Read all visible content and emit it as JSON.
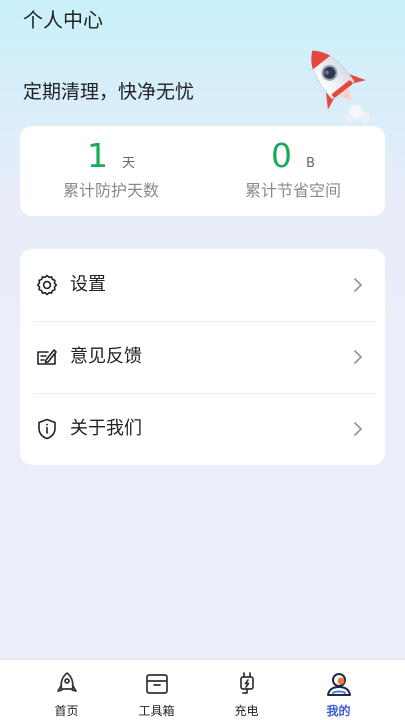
{
  "header": {
    "title": "个人中心",
    "slogan": "定期清理，快净无忧"
  },
  "stats": {
    "protection": {
      "value": "1",
      "unit": "天",
      "label": "累计防护天数"
    },
    "saved": {
      "value": "0",
      "unit": "B",
      "label": "累计节省空间"
    }
  },
  "menu": {
    "items": [
      {
        "label": "设置",
        "icon": "gear-icon"
      },
      {
        "label": "意见反馈",
        "icon": "feedback-icon"
      },
      {
        "label": "关于我们",
        "icon": "shield-info-icon"
      }
    ]
  },
  "tabbar": {
    "tabs": [
      {
        "label": "首页",
        "icon": "rocket-icon"
      },
      {
        "label": "工具箱",
        "icon": "toolbox-icon"
      },
      {
        "label": "充电",
        "icon": "charger-icon"
      },
      {
        "label": "我的",
        "icon": "user-icon"
      }
    ],
    "active_index": 3
  },
  "colors": {
    "accent": "#1aaa5a",
    "tab_active": "#3a5bd9",
    "rocket_red": "#e8473f"
  }
}
